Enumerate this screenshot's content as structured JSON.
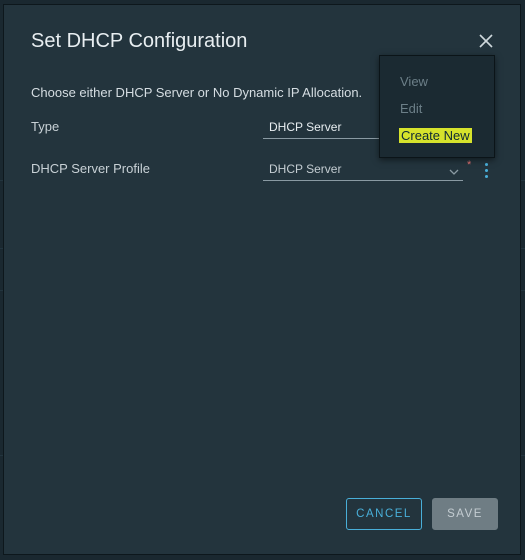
{
  "dialog": {
    "title": "Set DHCP Configuration",
    "close_icon": "close-icon",
    "instructions": "Choose either DHCP Server or No Dynamic IP Allocation."
  },
  "form": {
    "type": {
      "label": "Type",
      "value": "DHCP Server"
    },
    "profile": {
      "label": "DHCP Server Profile",
      "value": "DHCP Server",
      "required_mark": "*",
      "dropdown_icon": "chevron-down-icon",
      "menu_icon": "kebab-menu-icon"
    }
  },
  "context_menu": {
    "items": [
      {
        "label": "View",
        "state": "disabled"
      },
      {
        "label": "Edit",
        "state": "disabled"
      },
      {
        "label": "Create New",
        "state": "highlighted"
      }
    ]
  },
  "buttons": {
    "cancel": "CANCEL",
    "save": "SAVE"
  },
  "colors": {
    "dialog_bg": "#23343d",
    "accent": "#49afd9",
    "highlight": "#d6e32c",
    "required": "#e57373"
  }
}
